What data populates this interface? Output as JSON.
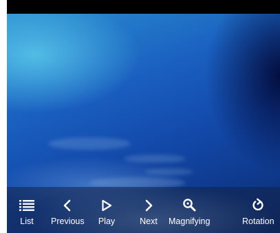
{
  "toolbar": {
    "list_label": "List",
    "previous_label": "Previous",
    "play_label": "Play",
    "next_label": "Next",
    "magnifying_label": "Magnifying",
    "rotation_label": "Rotation"
  },
  "icons": {
    "list": "list-icon",
    "previous": "chevron-left-icon",
    "play": "play-icon",
    "next": "chevron-right-icon",
    "magnifying": "magnify-icon",
    "rotation": "rotate-icon"
  },
  "colors": {
    "status_bar": "#000000",
    "toolbar_text": "#ffffff",
    "toolbar_bg": "#14234a"
  }
}
